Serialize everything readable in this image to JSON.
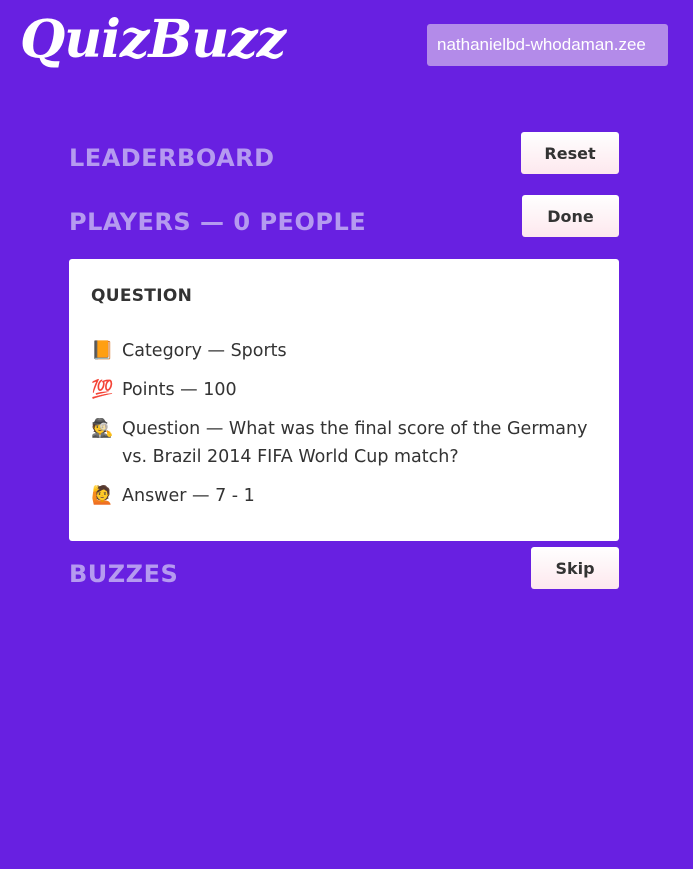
{
  "header": {
    "logo": "QuizBuzz",
    "room_value": "nathanielbd-whodaman.zee"
  },
  "sections": {
    "leaderboard_title": "LEADERBOARD",
    "players_title": "PLAYERS — 0 PEOPLE",
    "buzzes_title": "BUZZES"
  },
  "buttons": {
    "reset_label": "Reset",
    "done_label": "Done",
    "skip_label": "Skip"
  },
  "question_card": {
    "title": "QUESTION",
    "rows": [
      {
        "icon": "book-icon",
        "glyph": "📙",
        "text": "Category — Sports"
      },
      {
        "icon": "hundred-points-icon",
        "glyph": "💯",
        "text": "Points — 100"
      },
      {
        "icon": "detective-icon",
        "glyph": "🕵",
        "text": "Question — What was the final score of the Germany vs. Brazil 2014 FIFA World Cup match?"
      },
      {
        "icon": "person-raising-hand-icon",
        "glyph": "🙋",
        "text": "Answer — 7 - 1"
      }
    ]
  },
  "colors": {
    "background": "#6820e1",
    "section_title": "#b59af0",
    "input_background": "#b38be9",
    "card_background": "#ffffff",
    "button_gradient_end": "#fde8ee"
  }
}
